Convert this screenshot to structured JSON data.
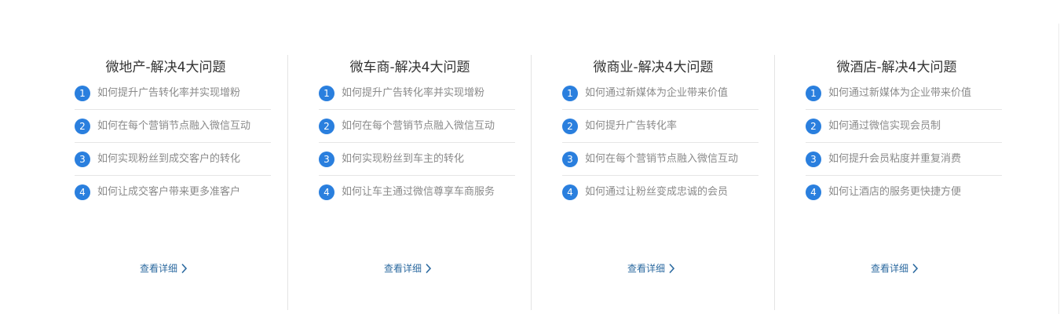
{
  "colors": {
    "badge": "#2a7fde",
    "link": "#2c6aa0",
    "title": "#333333",
    "item_text": "#8a8a8a",
    "divider": "#e6e6e6"
  },
  "columns": [
    {
      "title": "微地产-解决4大问题",
      "items": [
        {
          "num": "1",
          "text": "如何提升广告转化率并实现增粉"
        },
        {
          "num": "2",
          "text": "如何在每个营销节点融入微信互动"
        },
        {
          "num": "3",
          "text": "如何实现粉丝到成交客户的转化"
        },
        {
          "num": "4",
          "text": "如何让成交客户带来更多准客户"
        }
      ],
      "more_label": "查看详细",
      "more_icon": "chevron-right-icon"
    },
    {
      "title": "微车商-解决4大问题",
      "items": [
        {
          "num": "1",
          "text": "如何提升广告转化率并实现增粉"
        },
        {
          "num": "2",
          "text": "如何在每个营销节点融入微信互动"
        },
        {
          "num": "3",
          "text": "如何实现粉丝到车主的转化"
        },
        {
          "num": "4",
          "text": "如何让车主通过微信尊享车商服务"
        }
      ],
      "more_label": "查看详细",
      "more_icon": "chevron-right-icon"
    },
    {
      "title": "微商业-解决4大问题",
      "items": [
        {
          "num": "1",
          "text": "如何通过新媒体为企业带来价值"
        },
        {
          "num": "2",
          "text": "如何提升广告转化率"
        },
        {
          "num": "3",
          "text": "如何在每个营销节点融入微信互动"
        },
        {
          "num": "4",
          "text": "如何通过让粉丝变成忠诚的会员"
        }
      ],
      "more_label": "查看详细",
      "more_icon": "chevron-right-icon"
    },
    {
      "title": "微酒店-解决4大问题",
      "items": [
        {
          "num": "1",
          "text": "如何通过新媒体为企业带来价值"
        },
        {
          "num": "2",
          "text": "如何通过微信实现会员制"
        },
        {
          "num": "3",
          "text": "如何提升会员粘度并重复消费"
        },
        {
          "num": "4",
          "text": "如何让酒店的服务更快捷方便"
        }
      ],
      "more_label": "查看详细",
      "more_icon": "chevron-right-icon"
    }
  ]
}
